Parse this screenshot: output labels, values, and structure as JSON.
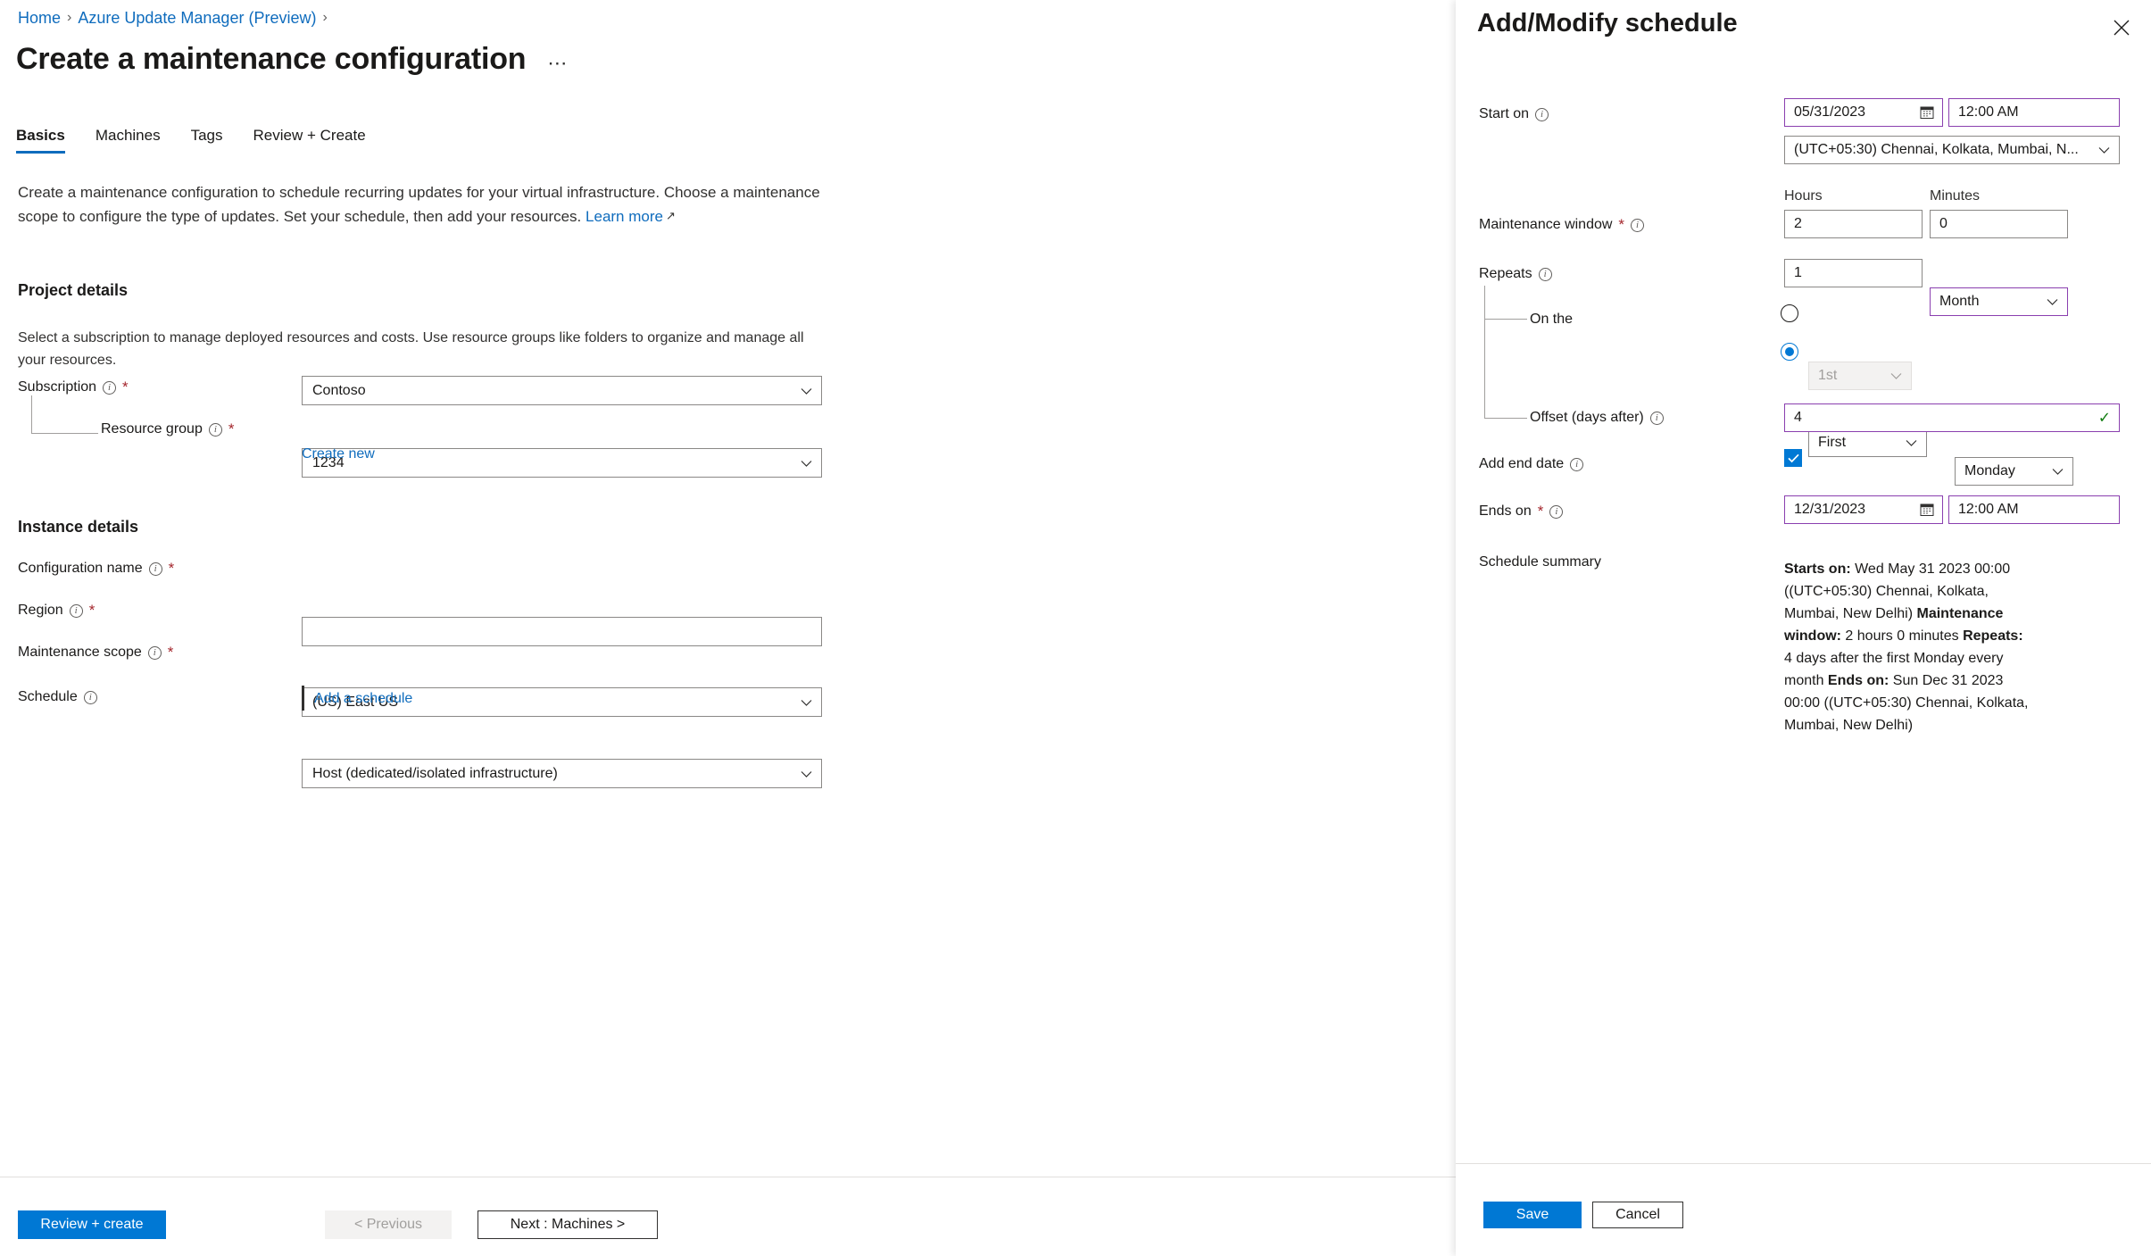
{
  "breadcrumb": {
    "items": [
      "Home",
      "Azure Update Manager (Preview)"
    ],
    "separator": "›"
  },
  "page": {
    "title": "Create a maintenance configuration",
    "more_actions": "⋯",
    "intro": "Create a maintenance configuration to schedule recurring updates for your virtual infrastructure. Choose a maintenance scope to configure the type of updates. Set your schedule, then add your resources.",
    "learn_more": "Learn more",
    "external_link_icon": "↗"
  },
  "tabs": [
    {
      "label": "Basics",
      "active": true
    },
    {
      "label": "Machines",
      "active": false
    },
    {
      "label": "Tags",
      "active": false
    },
    {
      "label": "Review + Create",
      "active": false
    }
  ],
  "project_details": {
    "heading": "Project details",
    "description": "Select a subscription to manage deployed resources and costs. Use resource groups like folders to organize and manage all your resources.",
    "subscription_label": "Subscription",
    "subscription_value": "Contoso",
    "resource_group_label": "Resource group",
    "resource_group_value": "1234",
    "create_new_link": "Create new"
  },
  "instance_details": {
    "heading": "Instance details",
    "configuration_name_label": "Configuration name",
    "configuration_name_value": "",
    "configuration_name_placeholder": "",
    "region_label": "Region",
    "region_value": "(US) East US",
    "maintenance_scope_label": "Maintenance scope",
    "maintenance_scope_value": "Host (dedicated/isolated infrastructure)",
    "schedule_label": "Schedule",
    "add_schedule_link": "Add a schedule"
  },
  "footer": {
    "review_create": "Review + create",
    "previous": "< Previous",
    "next": "Next : Machines >"
  },
  "panel": {
    "title": "Add/Modify schedule",
    "close_icon": "close-icon",
    "start_on_label": "Start on",
    "start_on_date": "05/31/2023",
    "start_on_time": "12:00 AM",
    "timezone": "(UTC+05:30) Chennai, Kolkata, Mumbai, N...",
    "maintenance_window_label": "Maintenance window",
    "hours_label": "Hours",
    "minutes_label": "Minutes",
    "hours_value": "2",
    "minutes_value": "0",
    "repeats_label": "Repeats",
    "repeats_count": "1",
    "repeats_unit": "Month",
    "on_the_label": "On the",
    "on_the_day_of_month": "1st",
    "on_the_ordinal": "First",
    "on_the_weekday": "Monday",
    "offset_label": "Offset (days after)",
    "offset_value": "4",
    "add_end_date_label": "Add end date",
    "add_end_date_checked": true,
    "ends_on_label": "Ends on",
    "ends_on_date": "12/31/2023",
    "ends_on_time": "12:00 AM",
    "summary_label": "Schedule summary",
    "summary": {
      "starts_on_key": "Starts on:",
      "starts_on_value": " Wed May 31 2023 00:00 ((UTC+05:30) Chennai, Kolkata, Mumbai, New Delhi)",
      "window_key": "Maintenance window:",
      "window_value": " 2 hours 0 minutes",
      "repeats_key": "Repeats:",
      "repeats_value": " 4 days after the first Monday every month",
      "ends_on_key": "Ends on:",
      "ends_on_value": " Sun Dec 31 2023 00:00 ((UTC+05:30) Chennai, Kolkata, Mumbai, New Delhi)"
    },
    "save": "Save",
    "cancel": "Cancel"
  },
  "colors": {
    "accent_blue": "#0078d4",
    "link_blue": "#0f6cbd",
    "focus_purple": "#8a3faf",
    "required_red": "#a4262c",
    "success_green": "#107c10"
  }
}
